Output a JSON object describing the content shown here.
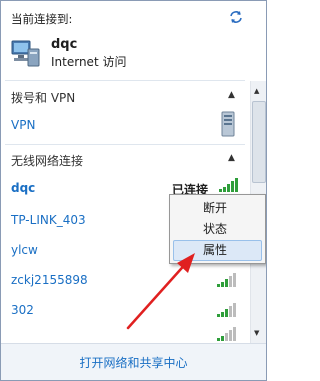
{
  "header": {
    "title": "当前连接到:",
    "refresh_icon": "refresh-icon"
  },
  "current": {
    "name": "dqc",
    "status": "Internet 访问",
    "icon": "network-computer-icon"
  },
  "sections": {
    "dialup": {
      "title": "拨号和 VPN"
    },
    "wireless": {
      "title": "无线网络连接"
    }
  },
  "vpn": {
    "label": "VPN",
    "icon": "vpn-server-icon"
  },
  "networks": [
    {
      "name": "dqc",
      "status": "已连接",
      "signal": 5
    },
    {
      "name": "TP-LINK_403",
      "status": "",
      "signal": 4
    },
    {
      "name": "ylcw",
      "status": "",
      "signal": 4
    },
    {
      "name": "zckj2155898",
      "status": "",
      "signal": 4
    },
    {
      "name": "302",
      "status": "",
      "signal": 3
    },
    {
      "name": "",
      "status": "",
      "signal": 3
    }
  ],
  "context_menu": {
    "items": [
      "断开",
      "状态",
      "属性"
    ],
    "highlighted": "属性"
  },
  "footer": {
    "link": "打开网络和共享中心"
  },
  "colors": {
    "link": "#1a6fc4",
    "signal": "#2e9e3a",
    "highlight": "#dce8f7",
    "arrow": "#e02020"
  }
}
